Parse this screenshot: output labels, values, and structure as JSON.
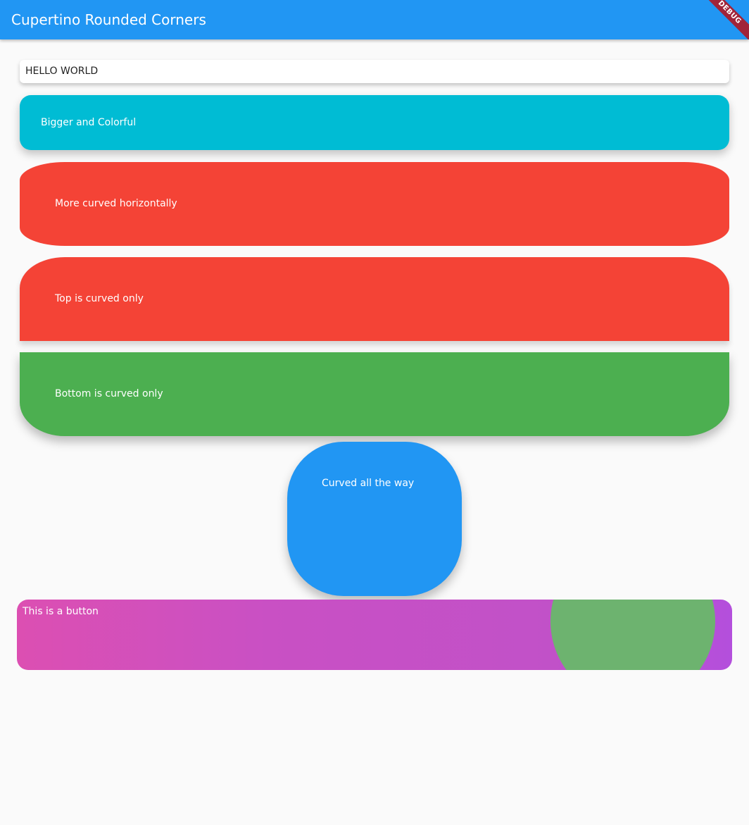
{
  "appbar": {
    "title": "Cupertino Rounded Corners",
    "debug_label": "DEBUG",
    "color": "#2196f3"
  },
  "cards": {
    "hello": {
      "label": "HELLO WORLD",
      "color": "#ffffff"
    },
    "bigger": {
      "label": "Bigger and Colorful",
      "color": "#00bcd4"
    },
    "horizontal": {
      "label": "More curved horizontally",
      "color": "#f44336"
    },
    "top_only": {
      "label": "Top is curved only",
      "color": "#f44336"
    },
    "bottom_only": {
      "label": "Bottom is curved only",
      "color": "#4caf50"
    },
    "all_way": {
      "label": "Curved all the way",
      "color": "#2196f3"
    }
  },
  "button": {
    "label": "This is a button",
    "gradient": [
      "#dc4fb2",
      "#b44fdc"
    ],
    "ripple_color": "#6db36f"
  }
}
